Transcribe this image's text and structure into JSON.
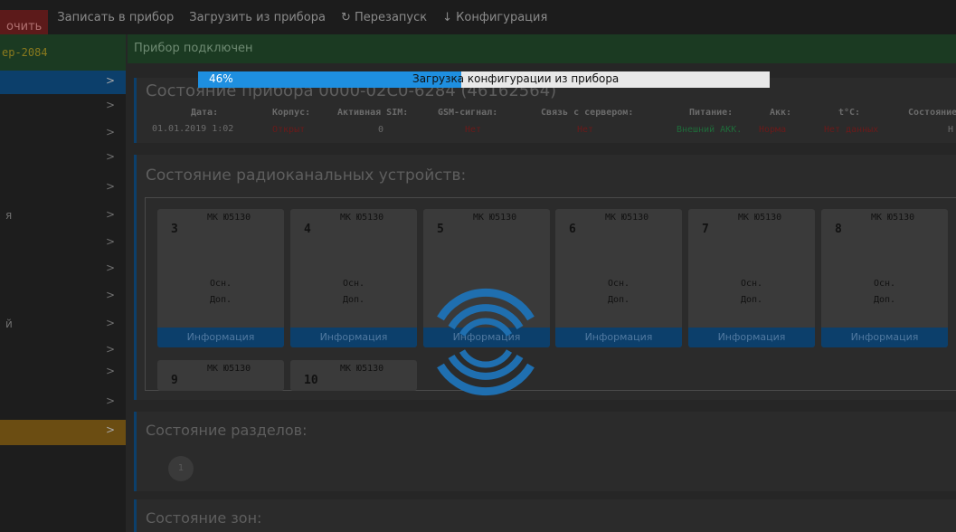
{
  "toolbar": {
    "clear_label": "очить",
    "write_label": "Записать в прибор",
    "load_label": "Загрузить из прибора",
    "restart_label": "Перезапуск",
    "restart_icon": "↻",
    "config_label": "Конфигурация",
    "config_icon": "↓"
  },
  "sidebar": {
    "device_name": "ер-2084",
    "items": [
      {
        "label": "",
        "chevron": ">"
      },
      {
        "label": "",
        "chevron": ">"
      },
      {
        "label": "",
        "chevron": ">"
      },
      {
        "label": "",
        "chevron": ">"
      },
      {
        "label": "",
        "chevron": ">"
      },
      {
        "label": "я",
        "chevron": ">"
      },
      {
        "label": "",
        "chevron": ">"
      },
      {
        "label": "",
        "chevron": ">"
      },
      {
        "label": "",
        "chevron": ">"
      },
      {
        "label": "й",
        "chevron": ">"
      },
      {
        "label": "",
        "chevron": ">"
      },
      {
        "label": "",
        "chevron": ">"
      },
      {
        "label": "",
        "chevron": ">"
      },
      {
        "label": "",
        "chevron": ">"
      }
    ]
  },
  "status_bar": {
    "text": "Прибор подключен"
  },
  "device_state": {
    "title": "Состояние прибора 0000-02C0-6284 (46162564)",
    "columns": [
      {
        "header": "Дата:",
        "value": "01.01.2019 1:02",
        "color": "#6b6b6b"
      },
      {
        "header": "Корпус:",
        "value": "Открыт",
        "color": "#6b1a1a"
      },
      {
        "header": "Активная SIM:",
        "value": "0",
        "color": "#6b6b6b"
      },
      {
        "header": "GSM-сигнал:",
        "value": "Нет",
        "color": "#6b1a1a"
      },
      {
        "header": "Связь с сервером:",
        "value": "Нет",
        "color": "#6b1a1a"
      },
      {
        "header": "Питание:",
        "value": "Внешний АКК.",
        "color": "#1f6b3a"
      },
      {
        "header": "Акк:",
        "value": "Норма",
        "color": "#6b1a1a"
      },
      {
        "header": "t°C:",
        "value": "Нет данных",
        "color": "#6b1a1a"
      },
      {
        "header": "Состояние:",
        "value": "Н",
        "color": "#6b6b6b"
      }
    ]
  },
  "radio_devices": {
    "title": "Состояние радиоканальных устройств:",
    "cards": [
      {
        "num": "3",
        "model": "МК Ю5130",
        "osn": "Осн.",
        "dop": "Доп.",
        "info": "Информация"
      },
      {
        "num": "4",
        "model": "МК Ю5130",
        "osn": "Осн.",
        "dop": "Доп.",
        "info": "Информация"
      },
      {
        "num": "5",
        "model": "МК Ю5130",
        "osn": "",
        "dop": "",
        "info": "Информация"
      },
      {
        "num": "6",
        "model": "МК Ю5130",
        "osn": "Осн.",
        "dop": "Доп.",
        "info": "Информация"
      },
      {
        "num": "7",
        "model": "МК Ю5130",
        "osn": "Осн.",
        "dop": "Доп.",
        "info": "Информация"
      },
      {
        "num": "8",
        "model": "МК Ю5130",
        "osn": "Осн.",
        "dop": "Доп.",
        "info": "Информация"
      },
      {
        "num": "9",
        "model": "МК Ю5130",
        "osn": "",
        "dop": "",
        "info": ""
      },
      {
        "num": "10",
        "model": "МК Ю5130",
        "osn": "",
        "dop": "",
        "info": ""
      }
    ]
  },
  "sections": {
    "title": "Состояние разделов:",
    "badge": "1"
  },
  "zones": {
    "title": "Состояние зон:"
  },
  "progress": {
    "percent_label": "46%",
    "percent": 46,
    "message": "Загрузка конфигурации из прибора"
  },
  "colors": {
    "accent_blue": "#1e8fe0",
    "spinner_blue": "#1f6fb0"
  }
}
